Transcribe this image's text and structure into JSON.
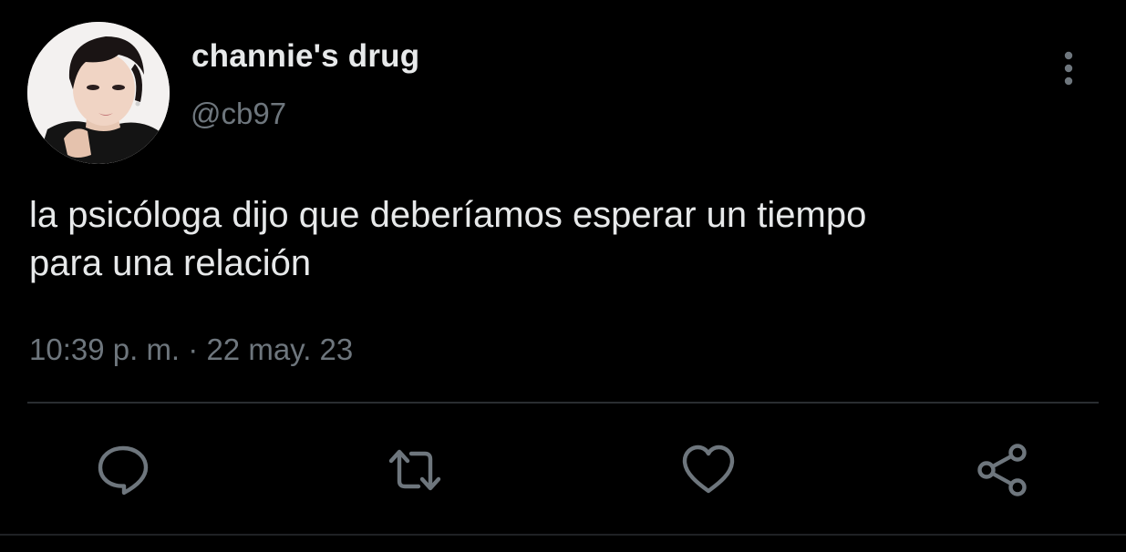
{
  "tweet": {
    "author": {
      "display_name": "channie's drug",
      "handle": "@cb97"
    },
    "text_lines": [
      "la psicóloga dijo que deberíamos esperar un tiempo",
      "para una relación"
    ],
    "time": "10:39 p. m.",
    "separator": "·",
    "date": "22 may. 23"
  },
  "actions": {
    "reply_icon": "reply-icon",
    "retweet_icon": "retweet-icon",
    "like_icon": "like-icon",
    "share_icon": "share-icon",
    "more_icon": "more-vertical-icon"
  },
  "colors": {
    "background": "#000000",
    "primary_text": "#e7e9ea",
    "secondary_text": "#6e767d",
    "divider": "#2a2d31"
  }
}
